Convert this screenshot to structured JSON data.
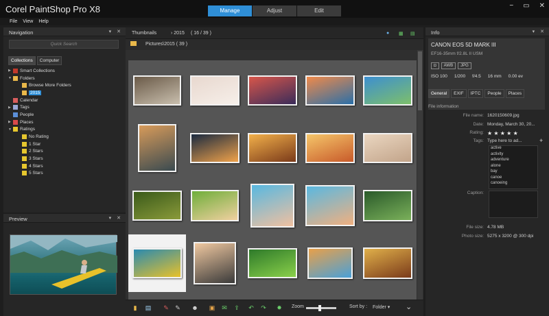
{
  "app": {
    "title": "Corel PaintShop Pro X8",
    "modes": [
      "Manage",
      "Adjust",
      "Edit"
    ],
    "active_mode": "Manage",
    "window_controls": [
      "−",
      "▭",
      "✕"
    ]
  },
  "menu": [
    "File",
    "View",
    "Help"
  ],
  "navigation": {
    "title": "Navigation",
    "controls": "▾ ✕",
    "search_placeholder": "Quick Search",
    "tabs": [
      "Collections",
      "Computer"
    ],
    "tree": [
      {
        "label": "Smart Collections",
        "depth": 0,
        "tri": "▶",
        "icon": "#c0392b"
      },
      {
        "label": "Folders",
        "depth": 0,
        "tri": "▼",
        "icon": "#e9b84a"
      },
      {
        "label": "Browse More Folders",
        "depth": 1,
        "tri": "",
        "icon": "#e9b84a"
      },
      {
        "label": "2015",
        "depth": 1,
        "tri": "",
        "icon": "#e9b84a",
        "selected": true
      },
      {
        "label": "Calendar",
        "depth": 0,
        "tri": "",
        "icon": "#d85d5d"
      },
      {
        "label": "Tags",
        "depth": 0,
        "tri": "▶",
        "icon": "#9aa8d8"
      },
      {
        "label": "People",
        "depth": 0,
        "tri": "",
        "icon": "#5b8fd8"
      },
      {
        "label": "Places",
        "depth": 0,
        "tri": "▶",
        "icon": "#d84a4a"
      },
      {
        "label": "Ratings",
        "depth": 0,
        "tri": "▼",
        "icon": "#e6c62e"
      },
      {
        "label": "No Rating",
        "depth": 1,
        "tri": "",
        "icon": "#e6c62e"
      },
      {
        "label": "1 Star",
        "depth": 1,
        "tri": "",
        "icon": "#e6c62e"
      },
      {
        "label": "2 Stars",
        "depth": 1,
        "tri": "",
        "icon": "#e6c62e"
      },
      {
        "label": "3 Stars",
        "depth": 1,
        "tri": "",
        "icon": "#e6c62e"
      },
      {
        "label": "4 Stars",
        "depth": 1,
        "tri": "",
        "icon": "#e6c62e"
      },
      {
        "label": "5 Stars",
        "depth": 1,
        "tri": "",
        "icon": "#e6c62e"
      }
    ]
  },
  "preview": {
    "title": "Preview",
    "controls": "▾ ✕"
  },
  "thumbnails": {
    "title": "Thumbnails",
    "breadcrumb": "› 2015",
    "count": "( 16 / 39 )",
    "path": "Pictures\\2015 ( 39 )"
  },
  "toolbar": {
    "zoom_label": "Zoom",
    "sort_label": "Sort by :",
    "sort_value": "Folder ▾",
    "zoom_level": 0.45
  },
  "info": {
    "title": "Info",
    "controls": "▾ ✕",
    "camera": "CANON EOS 5D MARK III",
    "lens": "EF16-35mm f/2.8L II USM",
    "badges": [
      "◘",
      "AWB",
      "JPG"
    ],
    "exif": [
      "ISO 100",
      "1/200",
      "f/4.5",
      "16 mm",
      "0.00 ev"
    ],
    "tabs": [
      "General",
      "EXIF",
      "IPTC",
      "People",
      "Places"
    ],
    "section": "File information",
    "filename_label": "File name:",
    "filename": "1620150609.jpg",
    "date_label": "Date:",
    "date": "Monday, March 30, 20...",
    "rating_label": "Rating:",
    "rating": "★ ★ ★ ★ ★",
    "tags_label": "Tags:",
    "tags_placeholder": "Type here to ad...",
    "tags": [
      "active",
      "activity",
      "adventure",
      "alone",
      "bay",
      "canoe",
      "canoeing"
    ],
    "caption_label": "Caption:",
    "filesize_label": "File size:",
    "filesize": "4.78 MB",
    "photosize_label": "Photo size:",
    "photosize": "5275 x 3200 @ 300 dpi"
  }
}
